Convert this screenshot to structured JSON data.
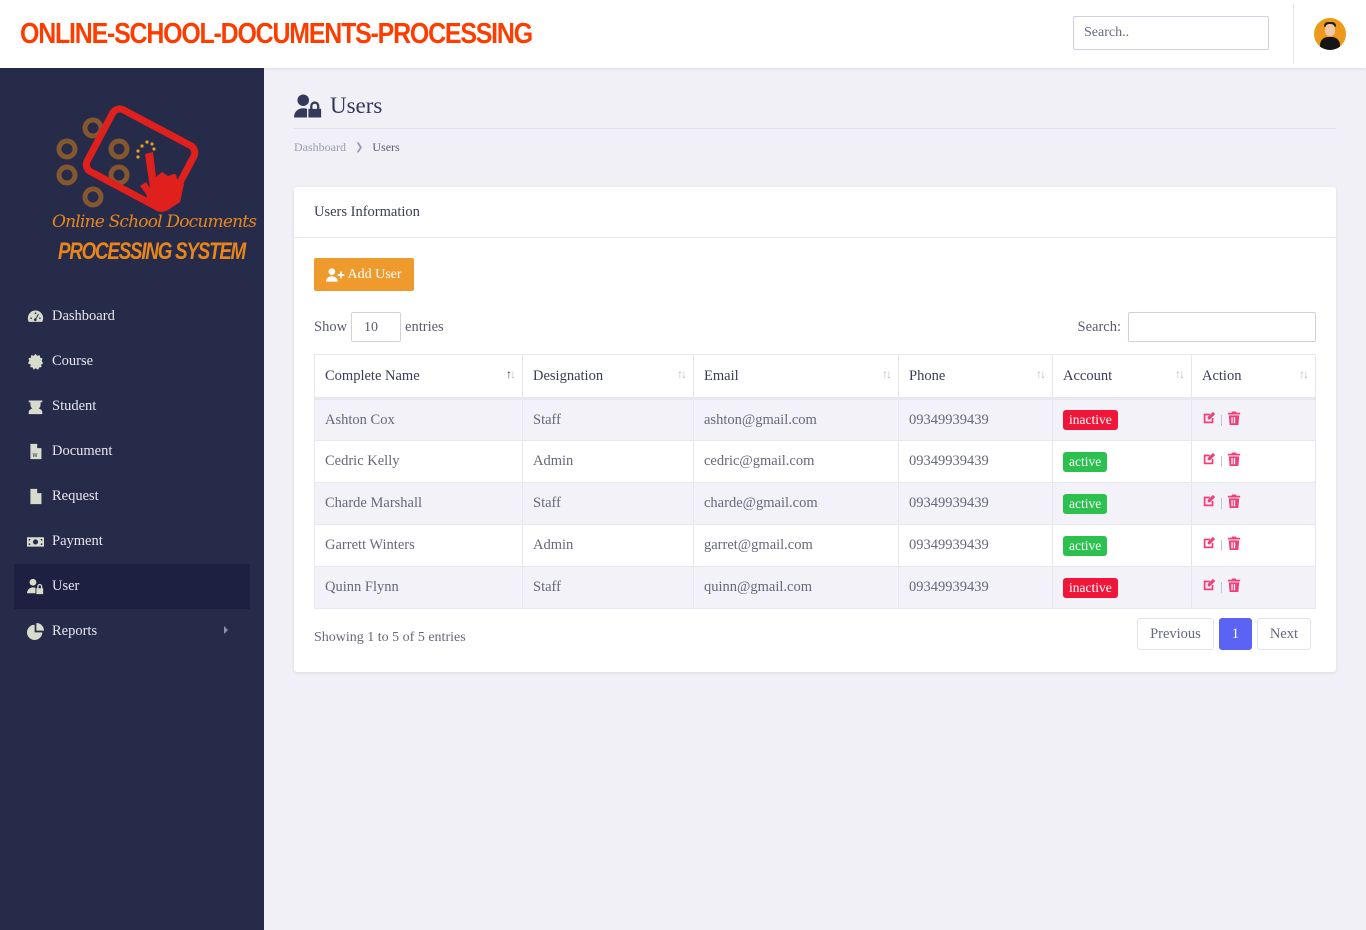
{
  "app": {
    "brand": "ONLINE-SCHOOL-DOCUMENTS-PROCESSING",
    "search_placeholder": "Search..",
    "colors": {
      "brand": "#ff3c00",
      "sidebar": "#272b4a",
      "accent": "#5b63f5",
      "add_button": "#ef9a2c",
      "inactive": "#f0163a",
      "active": "#2cc14f"
    }
  },
  "logo": {
    "line1": "Online School Documents",
    "line2": "PROCESSING SYSTEM"
  },
  "sidebar": {
    "items": [
      {
        "label": "Dashboard",
        "icon": "tachometer-icon"
      },
      {
        "label": "Course",
        "icon": "certificate-icon"
      },
      {
        "label": "Student",
        "icon": "graduate-icon"
      },
      {
        "label": "Document",
        "icon": "word-file-icon"
      },
      {
        "label": "Request",
        "icon": "file-icon"
      },
      {
        "label": "Payment",
        "icon": "money-bill-icon"
      },
      {
        "label": "User",
        "icon": "user-lock-icon",
        "active": true
      },
      {
        "label": "Reports",
        "icon": "pie-chart-icon",
        "has_submenu": true
      }
    ]
  },
  "page": {
    "title": "Users",
    "breadcrumb": [
      "Dashboard",
      "Users"
    ]
  },
  "card": {
    "title": "Users Information",
    "add_button": "Add User",
    "length_label_pre": "Show",
    "length_value": "10",
    "length_label_post": "entries",
    "search_label": "Search:",
    "search_value": "",
    "columns": [
      "Complete Name",
      "Designation",
      "Email",
      "Phone",
      "Account",
      "Action"
    ],
    "sorted_column": "Complete Name",
    "rows": [
      {
        "name": "Ashton Cox",
        "designation": "Staff",
        "email": "ashton@gmail.com",
        "phone": "09349939439",
        "account": "inactive"
      },
      {
        "name": "Cedric Kelly",
        "designation": "Admin",
        "email": "cedric@gmail.com",
        "phone": "09349939439",
        "account": "active"
      },
      {
        "name": "Charde Marshall",
        "designation": "Staff",
        "email": "charde@gmail.com",
        "phone": "09349939439",
        "account": "active"
      },
      {
        "name": "Garrett Winters",
        "designation": "Admin",
        "email": "garret@gmail.com",
        "phone": "09349939439",
        "account": "active"
      },
      {
        "name": "Quinn Flynn",
        "designation": "Staff",
        "email": "quinn@gmail.com",
        "phone": "09349939439",
        "account": "inactive"
      }
    ],
    "info": "Showing 1 to 5 of 5 entries",
    "pagination": {
      "previous": "Previous",
      "current": "1",
      "next": "Next"
    }
  }
}
